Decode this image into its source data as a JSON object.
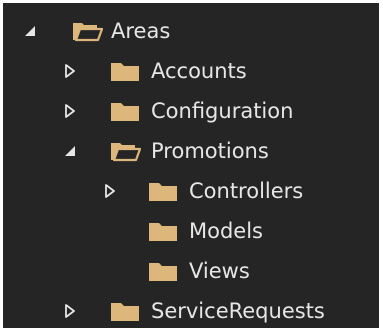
{
  "colors": {
    "background": "#252526",
    "text": "#e6e6e6",
    "folder": "#dcb67a",
    "arrow": "#e6e6e6"
  },
  "tree": [
    {
      "label": "Areas",
      "level": 0,
      "expander": "expanded",
      "icon": "folder-open-icon"
    },
    {
      "label": "Accounts",
      "level": 1,
      "expander": "collapsed",
      "icon": "folder-icon"
    },
    {
      "label": "Configuration",
      "level": 1,
      "expander": "collapsed",
      "icon": "folder-icon"
    },
    {
      "label": "Promotions",
      "level": 1,
      "expander": "expanded",
      "icon": "folder-open-icon"
    },
    {
      "label": "Controllers",
      "level": 2,
      "expander": "collapsed",
      "icon": "folder-icon"
    },
    {
      "label": "Models",
      "level": 2,
      "expander": "none",
      "icon": "folder-icon"
    },
    {
      "label": "Views",
      "level": 2,
      "expander": "none",
      "icon": "folder-icon"
    },
    {
      "label": "ServiceRequests",
      "level": 1,
      "expander": "collapsed",
      "icon": "folder-icon"
    }
  ]
}
